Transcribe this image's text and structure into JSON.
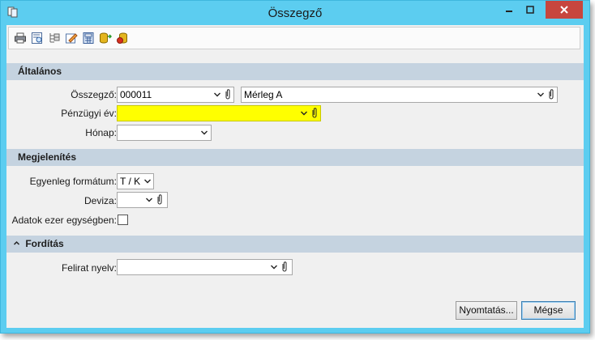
{
  "window": {
    "title": "Összegző"
  },
  "toolbar": {
    "icons": [
      "print-icon",
      "preview-icon",
      "tree-icon",
      "edit-icon",
      "calculator-icon",
      "database-export-icon",
      "database-import-icon"
    ]
  },
  "sections": {
    "general": {
      "title": "Általános"
    },
    "display": {
      "title": "Megjelenítés"
    },
    "translation": {
      "title": "Fordítás"
    }
  },
  "fields": {
    "summarizer": {
      "label": "Összegző:",
      "code": "000011",
      "name": "Mérleg A"
    },
    "fiscal_year": {
      "label": "Pénzügyi év:",
      "value": ""
    },
    "month": {
      "label": "Hónap:",
      "value": ""
    },
    "balance_format": {
      "label": "Egyenleg formátum:",
      "value": "T / K"
    },
    "currency": {
      "label": "Deviza:",
      "value": ""
    },
    "thousands": {
      "label": "Adatok ezer egységben:",
      "checked": false
    },
    "caption_language": {
      "label": "Felirat nyelv:",
      "value": ""
    }
  },
  "buttons": {
    "print": "Nyomtatás...",
    "cancel": "Mégse"
  },
  "colors": {
    "titlebar": "#5ccdf0",
    "section": "#c5d3e0",
    "required": "#ffff00",
    "close": "#c7463e"
  }
}
